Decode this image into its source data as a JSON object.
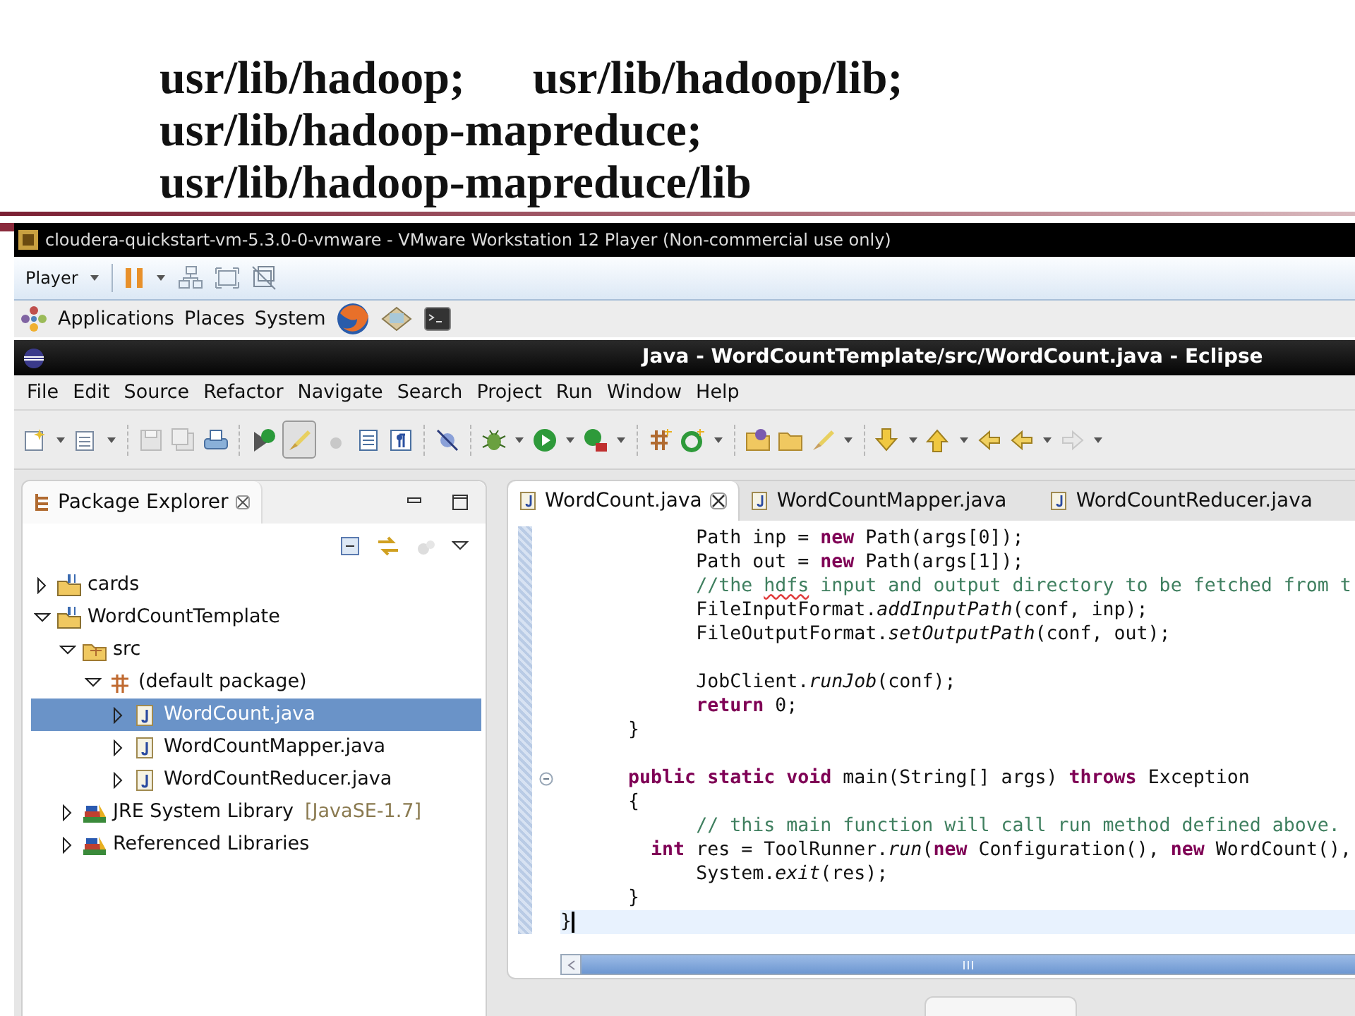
{
  "slide": {
    "heading_lines": [
      [
        "usr/lib/hadoop;",
        "usr/lib/hadoop/lib;"
      ],
      [
        "usr/lib/hadoop-mapreduce;"
      ],
      [
        "usr/lib/hadoop-mapreduce/lib"
      ]
    ]
  },
  "vm_window": {
    "title": "cloudera-quickstart-vm-5.3.0-0-vmware - VMware Workstation 12 Player (Non-commercial use only)",
    "player_menu": "Player"
  },
  "desktop_panel": {
    "menus": [
      "Applications",
      "Places",
      "System"
    ]
  },
  "eclipse": {
    "title": "Java - WordCountTemplate/src/WordCount.java - Eclipse",
    "menu": [
      "File",
      "Edit",
      "Source",
      "Refactor",
      "Navigate",
      "Search",
      "Project",
      "Run",
      "Window",
      "Help"
    ],
    "package_explorer": {
      "title": "Package Explorer",
      "tree": [
        {
          "label": "cards",
          "kind": "project",
          "expanded": false,
          "selected": false
        },
        {
          "label": "WordCountTemplate",
          "kind": "project",
          "expanded": true,
          "selected": false,
          "children": [
            {
              "label": "src",
              "kind": "folder",
              "expanded": true,
              "selected": false,
              "children": [
                {
                  "label": "(default package)",
                  "kind": "package",
                  "expanded": true,
                  "selected": false,
                  "children": [
                    {
                      "label": "WordCount.java",
                      "kind": "java",
                      "expanded": false,
                      "selected": true
                    },
                    {
                      "label": "WordCountMapper.java",
                      "kind": "java",
                      "expanded": false,
                      "selected": false
                    },
                    {
                      "label": "WordCountReducer.java",
                      "kind": "java",
                      "expanded": false,
                      "selected": false
                    }
                  ]
                }
              ]
            },
            {
              "label": "JRE System Library",
              "decoration": "[JavaSE-1.7]",
              "kind": "library",
              "expanded": false,
              "selected": false
            },
            {
              "label": "Referenced Libraries",
              "kind": "library",
              "expanded": false,
              "selected": false
            }
          ]
        }
      ]
    },
    "editor": {
      "tabs": [
        {
          "label": "WordCount.java",
          "selected": true
        },
        {
          "label": "WordCountMapper.java",
          "selected": false
        },
        {
          "label": "WordCountReducer.java",
          "selected": false
        }
      ],
      "lines": [
        {
          "kind": "code",
          "current": false,
          "fold": false,
          "segments": [
            {
              "kind": "plain",
              "t": "            Path inp = "
            },
            {
              "kind": "keyword",
              "t": "new"
            },
            {
              "kind": "plain",
              "t": " Path(args[0]);"
            }
          ]
        },
        {
          "kind": "code",
          "current": false,
          "fold": false,
          "segments": [
            {
              "kind": "plain",
              "t": "            Path out = "
            },
            {
              "kind": "keyword",
              "t": "new"
            },
            {
              "kind": "plain",
              "t": " Path(args[1]);"
            }
          ]
        },
        {
          "kind": "code",
          "current": false,
          "fold": false,
          "segments": [
            {
              "kind": "comment",
              "t": "            //the "
            },
            {
              "kind": "misspelled",
              "t": "hdfs"
            },
            {
              "kind": "comment",
              "t": " input and output directory to be fetched from t"
            }
          ]
        },
        {
          "kind": "code",
          "current": false,
          "fold": false,
          "segments": [
            {
              "kind": "plain",
              "t": "            FileInputFormat."
            },
            {
              "kind": "italic",
              "t": "addInputPath"
            },
            {
              "kind": "plain",
              "t": "(conf, inp);"
            }
          ]
        },
        {
          "kind": "code",
          "current": false,
          "fold": false,
          "segments": [
            {
              "kind": "plain",
              "t": "            FileOutputFormat."
            },
            {
              "kind": "italic",
              "t": "setOutputPath"
            },
            {
              "kind": "plain",
              "t": "(conf, out);"
            }
          ]
        },
        {
          "kind": "blank",
          "current": false,
          "fold": false
        },
        {
          "kind": "code",
          "current": false,
          "fold": false,
          "segments": [
            {
              "kind": "plain",
              "t": "            JobClient."
            },
            {
              "kind": "italic",
              "t": "runJob"
            },
            {
              "kind": "plain",
              "t": "(conf);"
            }
          ]
        },
        {
          "kind": "code",
          "current": false,
          "fold": false,
          "segments": [
            {
              "kind": "keyword",
              "t": "            return"
            },
            {
              "kind": "plain",
              "t": " 0;"
            }
          ]
        },
        {
          "kind": "code",
          "current": false,
          "fold": false,
          "segments": [
            {
              "kind": "plain",
              "t": "      }"
            }
          ]
        },
        {
          "kind": "blank",
          "current": false,
          "fold": false
        },
        {
          "kind": "code",
          "current": false,
          "fold": true,
          "segments": [
            {
              "kind": "keyword",
              "t": "      public static void"
            },
            {
              "kind": "plain",
              "t": " main(String[] args) "
            },
            {
              "kind": "keyword",
              "t": "throws"
            },
            {
              "kind": "plain",
              "t": " Exception"
            }
          ]
        },
        {
          "kind": "code",
          "current": false,
          "fold": false,
          "segments": [
            {
              "kind": "plain",
              "t": "      {"
            }
          ]
        },
        {
          "kind": "code",
          "current": false,
          "fold": false,
          "segments": [
            {
              "kind": "comment",
              "t": "            // this main function will call run method defined above."
            }
          ]
        },
        {
          "kind": "code",
          "current": false,
          "fold": false,
          "segments": [
            {
              "kind": "keyword",
              "t": "        int"
            },
            {
              "kind": "plain",
              "t": " res = ToolRunner."
            },
            {
              "kind": "italic",
              "t": "run"
            },
            {
              "kind": "plain",
              "t": "("
            },
            {
              "kind": "keyword",
              "t": "new"
            },
            {
              "kind": "plain",
              "t": " Configuration(), "
            },
            {
              "kind": "keyword",
              "t": "new"
            },
            {
              "kind": "plain",
              "t": " WordCount(),"
            }
          ]
        },
        {
          "kind": "code",
          "current": false,
          "fold": false,
          "segments": [
            {
              "kind": "plain",
              "t": "            System."
            },
            {
              "kind": "italic",
              "t": "exit"
            },
            {
              "kind": "plain",
              "t": "(res);"
            }
          ]
        },
        {
          "kind": "code",
          "current": false,
          "fold": false,
          "segments": [
            {
              "kind": "plain",
              "t": "      }"
            }
          ]
        },
        {
          "kind": "code",
          "current": true,
          "fold": false,
          "segments": [
            {
              "kind": "plain",
              "t": "}"
            }
          ]
        }
      ]
    }
  }
}
